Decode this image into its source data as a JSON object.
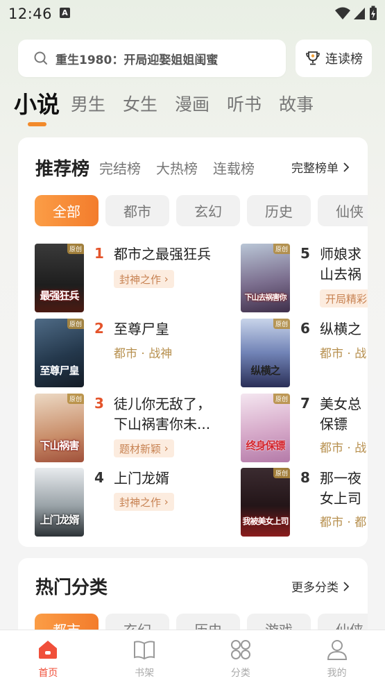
{
  "status": {
    "time": "12:46",
    "indicator": "A"
  },
  "search": {
    "placeholder": "重生1980：开局迎娶姐姐闺蜜"
  },
  "rank_button": {
    "label": "连读榜"
  },
  "top_tabs": [
    "小说",
    "男生",
    "女生",
    "漫画",
    "听书",
    "故事"
  ],
  "ranking": {
    "tabs": [
      "推荐榜",
      "完结榜",
      "大热榜",
      "连载榜"
    ],
    "full_list_label": "完整榜单",
    "chips": [
      "全部",
      "都市",
      "玄幻",
      "历史",
      "仙侠"
    ],
    "books": [
      {
        "rank": "1",
        "title": "都市之最强狂兵",
        "tag": "封神之作",
        "cover_text": "最强狂兵",
        "badge": "原创"
      },
      {
        "rank": "2",
        "title": "至尊尸皇",
        "meta": "都市 · 战神",
        "cover_text": "至尊尸皇",
        "badge": "原创"
      },
      {
        "rank": "3",
        "title_line1": "徒儿你无敌了，",
        "title_line2": "下山祸害你未...",
        "tag": "题材新颖",
        "cover_text": "下山祸害",
        "badge": "原创"
      },
      {
        "rank": "4",
        "title": "上门龙婿",
        "tag": "封神之作",
        "cover_text": "上门龙婿"
      },
      {
        "rank": "5",
        "title_line1": "师娘求",
        "title_line2": "山去祸",
        "tag": "开局精彩",
        "cover_text": "下山去祸害你",
        "badge": "原创"
      },
      {
        "rank": "6",
        "title": "纵横之",
        "meta": "都市 · 战",
        "cover_text": "纵横之",
        "badge": "原创"
      },
      {
        "rank": "7",
        "title_line1": "美女总",
        "title_line2": "保镖",
        "meta": "都市 · 战",
        "cover_text": "终身保镖",
        "badge": "原创"
      },
      {
        "rank": "8",
        "title_line1": "那一夜",
        "title_line2": "女上司",
        "meta": "都市 · 都",
        "cover_text": "我被美女上司",
        "badge": "原创"
      }
    ]
  },
  "categories": {
    "title": "热门分类",
    "more_label": "更多分类",
    "chips": [
      "都市",
      "玄幻",
      "历史",
      "游戏",
      "仙侠"
    ]
  },
  "bottom_nav": [
    {
      "label": "首页",
      "icon": "home-icon",
      "active": true
    },
    {
      "label": "书架",
      "icon": "book-icon"
    },
    {
      "label": "分类",
      "icon": "grid-icon"
    },
    {
      "label": "我的",
      "icon": "user-icon"
    }
  ],
  "colors": {
    "accent": "#f37c2c",
    "rank_hot": "#e4542b",
    "nav_active": "#f04f3a"
  }
}
